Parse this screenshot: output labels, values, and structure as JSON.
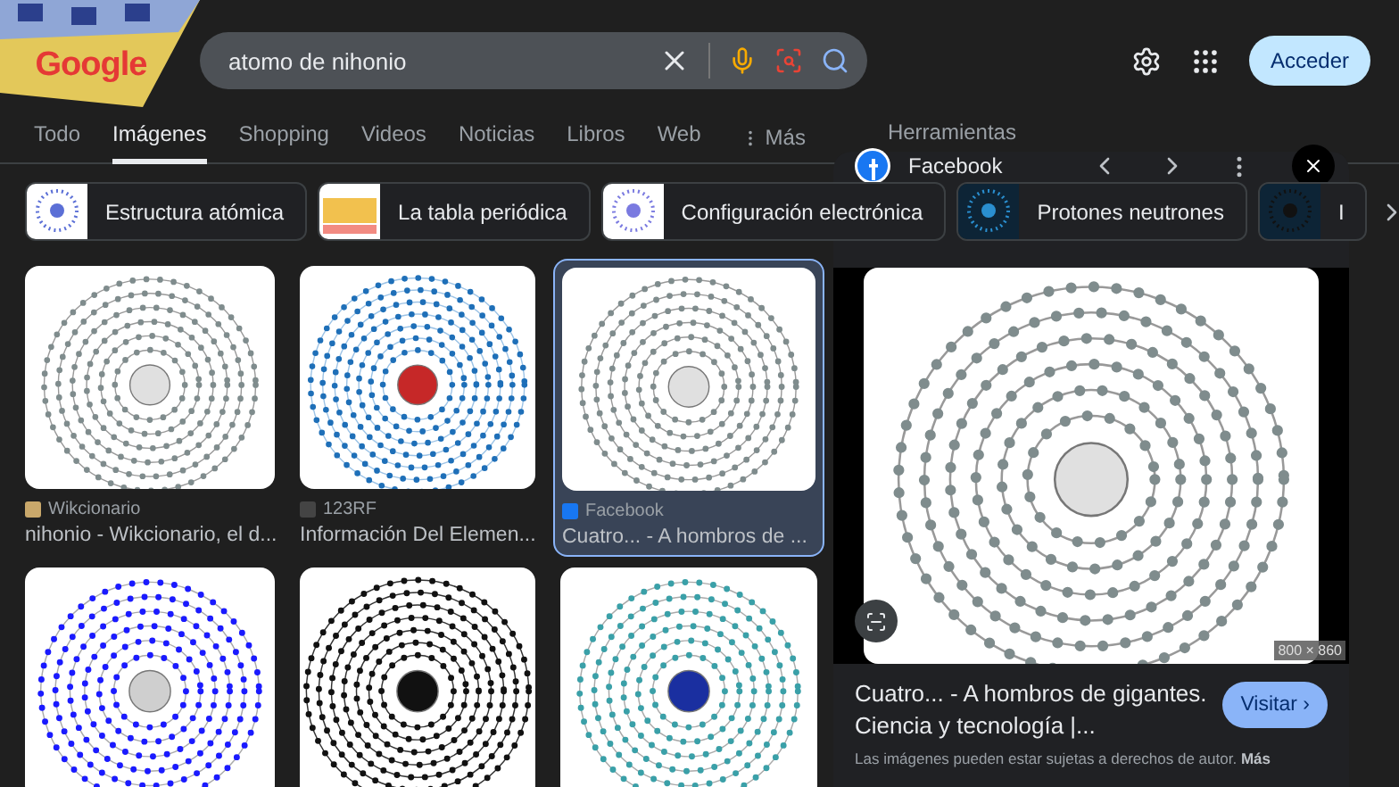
{
  "logo": {
    "text": "Google"
  },
  "search": {
    "value": "atomo de nihonio"
  },
  "signin_button": "Acceder",
  "tabs": [
    {
      "label": "Todo",
      "selected": false
    },
    {
      "label": "Imágenes",
      "selected": true
    },
    {
      "label": "Shopping",
      "selected": false
    },
    {
      "label": "Videos",
      "selected": false
    },
    {
      "label": "Noticias",
      "selected": false
    },
    {
      "label": "Libros",
      "selected": false
    },
    {
      "label": "Web",
      "selected": false
    }
  ],
  "more_menu": "Más",
  "tools": "Herramientas",
  "chips": [
    {
      "label": "Estructura atómica"
    },
    {
      "label": "La tabla periódica"
    },
    {
      "label": "Configuración electrónica"
    },
    {
      "label": "Protones neutrones"
    },
    {
      "label": "I"
    }
  ],
  "results": [
    {
      "source": "Wikcionario",
      "title": "nihonio - Wikcionario, el d...",
      "selected": false
    },
    {
      "source": "123RF",
      "title": "Información Del Elemen...",
      "selected": false
    },
    {
      "source": "Facebook",
      "title": "Cuatro... - A hombros de ...",
      "selected": true
    },
    {
      "selected": false
    },
    {
      "selected": false
    },
    {
      "selected": false
    }
  ],
  "preview": {
    "source": "Facebook",
    "dimensions": "800 × 860",
    "title": "Cuatro... - A hombros de gigantes. Ciencia y tecnología |...",
    "visit_button": "Visitar ›",
    "notice": "Las imágenes pueden estar sujetas a derechos de autor.",
    "notice_link": "Más"
  }
}
